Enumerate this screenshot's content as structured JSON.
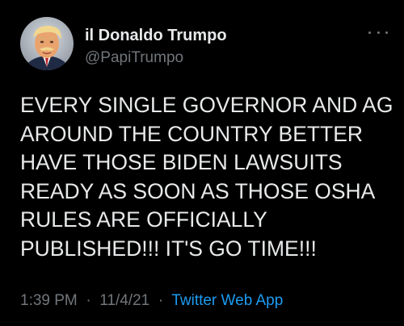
{
  "tweet": {
    "author": {
      "display_name": "il Donaldo Trumpo",
      "handle": "@PapiTrumpo"
    },
    "text_lines": [
      "EVERY SINGLE GOVERNOR AND AG",
      "AROUND THE COUNTRY BETTER",
      "HAVE THOSE BIDEN LAWSUITS",
      "READY AS SOON AS THOSE OSHA",
      "RULES ARE OFFICIALLY",
      "PUBLISHED!!! IT'S GO TIME!!!"
    ],
    "time": "1:39 PM",
    "separator": "·",
    "date": "11/4/21",
    "source": "Twitter Web App"
  },
  "icons": {
    "more": "more-horizontal-icon"
  },
  "colors": {
    "background": "#000000",
    "primary_text": "#e7e9ea",
    "secondary_text": "#71767b",
    "link": "#1d9bf0"
  }
}
